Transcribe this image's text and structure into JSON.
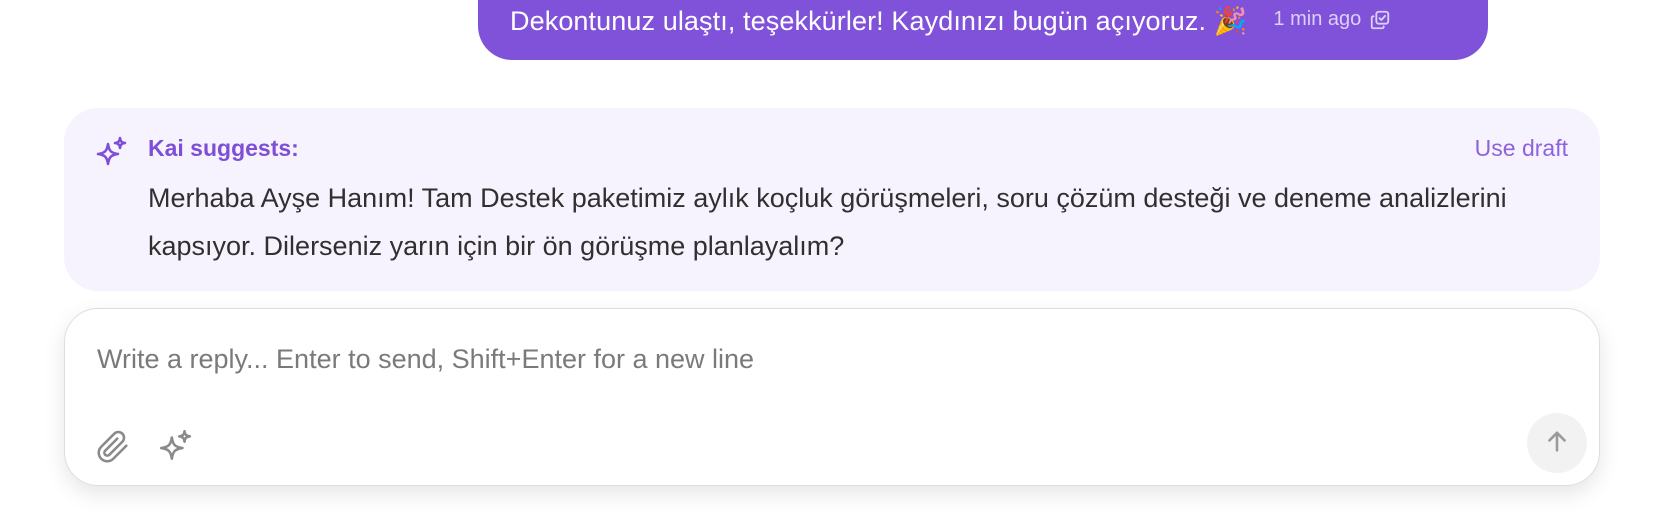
{
  "sent_message": {
    "text": "Dekontunuz ulaştı, teşekkürler! Kaydınızı bugün açıyoruz. 🎉",
    "time": "1 min ago",
    "copy_icon": "copy-icon"
  },
  "suggestion": {
    "icon": "sparkle-icon",
    "title": "Kai suggests:",
    "use_draft_label": "Use draft",
    "body": "Merhaba Ayşe Hanım! Tam Destek paketimiz aylık koçluk görüşmeleri, soru çözüm desteği ve deneme analizlerini kapsıyor. Dilerseniz yarın için bir ön görüşme planlayalım?"
  },
  "composer": {
    "value": "",
    "placeholder": "Write a reply... Enter to send, Shift+Enter for a new line",
    "attach_icon": "paperclip-icon",
    "ai_icon": "sparkle-icon",
    "send_icon": "arrow-up-icon"
  },
  "colors": {
    "accent": "#8052d9",
    "suggest_bg": "#f7f3fe",
    "suggest_title": "#7d4fd6"
  }
}
